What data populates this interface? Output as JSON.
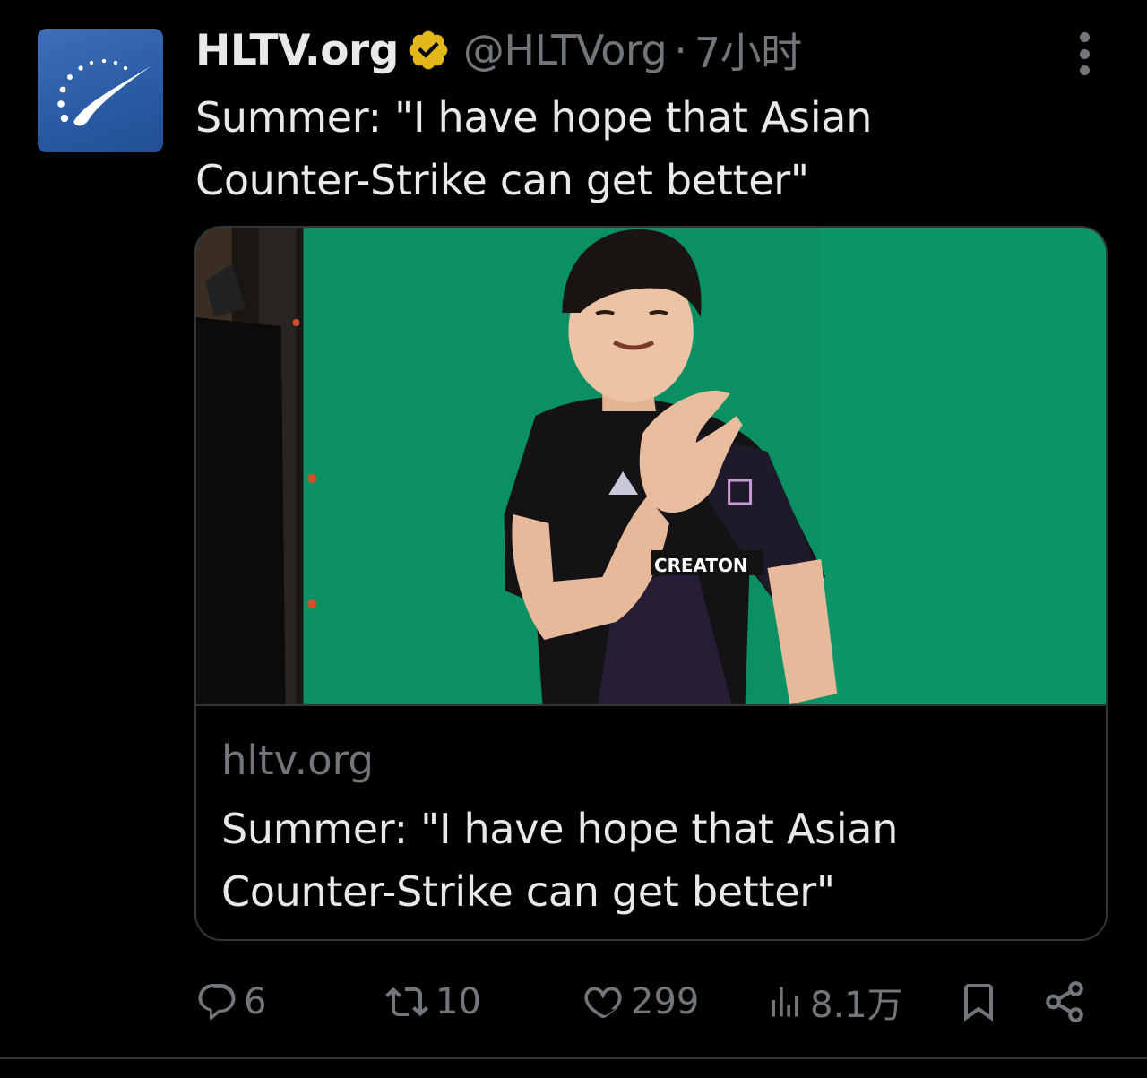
{
  "tweet": {
    "author_name": "HLTV.org",
    "handle": "@HLTVorg",
    "separator": "·",
    "time": "7小时",
    "verified": true,
    "text": "Summer: \"I have hope that Asian Counter-Strike can get better\""
  },
  "card": {
    "domain": "hltv.org",
    "title": "Summer: \"I have hope that Asian Counter-Strike can get better\"",
    "jersey_text": "CREATON"
  },
  "actions": {
    "replies": "6",
    "retweets": "10",
    "likes": "299",
    "views": "8.1万"
  },
  "icons": {
    "verified_badge": "verified-badge-icon",
    "more": "more-options-icon",
    "reply": "reply-icon",
    "retweet": "retweet-icon",
    "like": "heart-icon",
    "views": "views-icon",
    "bookmark": "bookmark-icon",
    "share": "share-icon"
  },
  "colors": {
    "background": "#000000",
    "text_primary": "#e7e9ea",
    "text_secondary": "#71767b",
    "border": "#333639",
    "verified_gold": "#e2b719",
    "avatar_blue": "#2f62ad",
    "photo_green": "#0a9063"
  }
}
